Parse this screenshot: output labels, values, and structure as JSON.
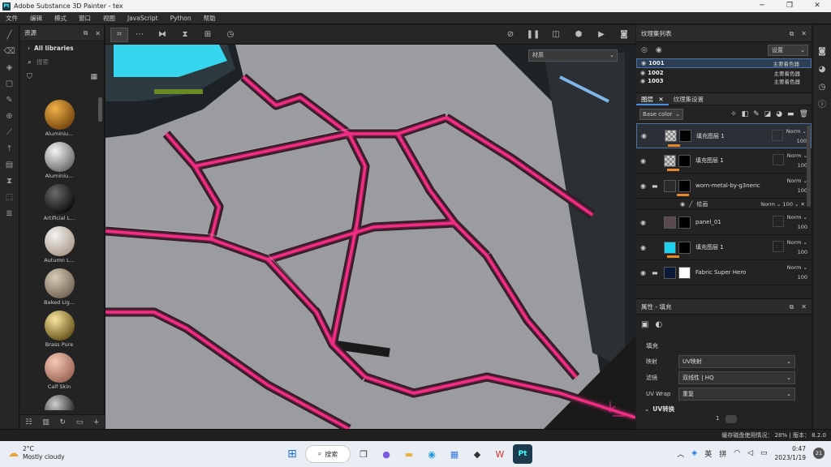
{
  "app": {
    "title": "Adobe Substance 3D Painter - tex",
    "icon_text": "Pt"
  },
  "menu": [
    "文件",
    "编辑",
    "模式",
    "窗口",
    "视图",
    "JavaScript",
    "Python",
    "帮助"
  ],
  "assets": {
    "title": "资源",
    "library": "All libraries",
    "search_placeholder": "搜索",
    "materials": [
      {
        "name": "Aluminiu...",
        "color1": "#f0b048",
        "color2": "#7a4a10"
      },
      {
        "name": "Aluminiu...",
        "color1": "#f4f4f4",
        "color2": "#707070"
      },
      {
        "name": "Artificial L...",
        "color1": "#6a6a6a",
        "color2": "#101010"
      },
      {
        "name": "Autumn L...",
        "color1": "#f2f2f2",
        "color2": "#b0a090"
      },
      {
        "name": "Baked Lig...",
        "color1": "#d8cbb8",
        "color2": "#786a58"
      },
      {
        "name": "Brass Pure",
        "color1": "#f8e6a0",
        "color2": "#6e5a20"
      },
      {
        "name": "Calf Skin",
        "color1": "#f6c8b6",
        "color2": "#a06a5a"
      },
      {
        "name": "",
        "color1": "#cfcfcf",
        "color2": "#202020"
      }
    ]
  },
  "viewport": {
    "material_dropdown": "材质"
  },
  "texture_set_list": {
    "title": "纹理集列表",
    "settings_label": "设置",
    "items": [
      {
        "name": "1001",
        "shader": "主要着色器"
      },
      {
        "name": "1002",
        "shader": "主要着色器"
      },
      {
        "name": "1003",
        "shader": "主要着色器"
      }
    ]
  },
  "layers": {
    "tab_layers": "图层",
    "tab_texset": "纹理集设置",
    "channel": "Base color",
    "items": [
      {
        "name": "填充图层 1",
        "blend": "Norm",
        "opacity": "100",
        "thumb": "checker",
        "mask_color": "#000000"
      },
      {
        "name": "填充图层 1",
        "blend": "Norm",
        "opacity": "100",
        "thumb": "checker",
        "mask_color": "#000000"
      },
      {
        "name": "worn-metal-by-g3neric",
        "blend": "Norm",
        "opacity": "100",
        "thumb": "#2a2a2a",
        "mask_color": "#000000"
      },
      {
        "name": "panel_01",
        "blend": "Norm",
        "opacity": "100",
        "thumb": "#5a4a50",
        "mask_color": "#000000"
      },
      {
        "name": "填充图层 1",
        "blend": "Norm",
        "opacity": "100",
        "thumb": "#1ed2ee",
        "mask_color": "#000000"
      },
      {
        "name": "Fabric Super Hero",
        "blend": "Norm",
        "opacity": "100",
        "thumb": "#0c1a3a",
        "mask_color": "#000000"
      }
    ],
    "sub_item": {
      "name": "绘画",
      "blend": "Norm",
      "opacity": "100"
    }
  },
  "properties": {
    "title": "属性 - 填充",
    "section": "填充",
    "mapping_label": "映射",
    "mapping_value": "UV映射",
    "filter_label": "滤镜",
    "filter_value": "双线性 | HQ",
    "uvwrap_label": "UV Wrap",
    "uvwrap_value": "重复",
    "uv_transform": "UV转换",
    "tile_value": "1"
  },
  "status": {
    "text": "缓存磁盘使用情况： 28% | 版本： 8.2.0"
  },
  "taskbar": {
    "temp": "2°C",
    "weather": "Mostly cloudy",
    "search": "搜索",
    "ime1": "英",
    "ime2": "拼",
    "time": "0:47",
    "date": "2023/1/19",
    "notif": "21"
  },
  "colors": {
    "accent": "#4a90e2",
    "glow": "#ff2d8a",
    "cyan": "#1ed2ee",
    "orange": "#e8862a"
  }
}
